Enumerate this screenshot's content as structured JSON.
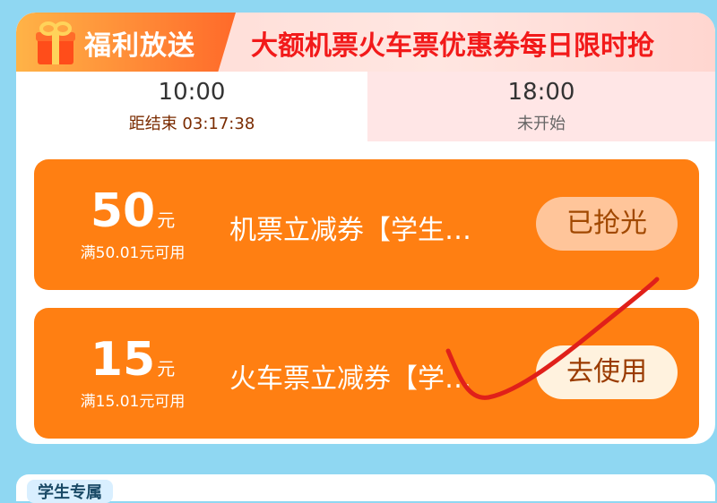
{
  "banner": {
    "badge_text": "福利放送",
    "title": "大额机票火车票优惠券每日限时抢"
  },
  "tabs": [
    {
      "time": "10:00",
      "sub": "距结束 03:17:38",
      "active": true
    },
    {
      "time": "18:00",
      "sub": "未开始",
      "active": false
    }
  ],
  "coupons": [
    {
      "amount": "50",
      "unit": "元",
      "condition": "满50.01元可用",
      "name": "机票立减券【学生…",
      "button": "已抢光"
    },
    {
      "amount": "15",
      "unit": "元",
      "condition": "满15.01元可用",
      "name": "火车票立减券【学…",
      "button": "去使用"
    }
  ],
  "next_section": {
    "label": "学生专属"
  },
  "colors": {
    "background": "#8fd7f2",
    "coupon": "#ff7f12",
    "title_red": "#f21a1a",
    "scribble": "#e0201a"
  }
}
